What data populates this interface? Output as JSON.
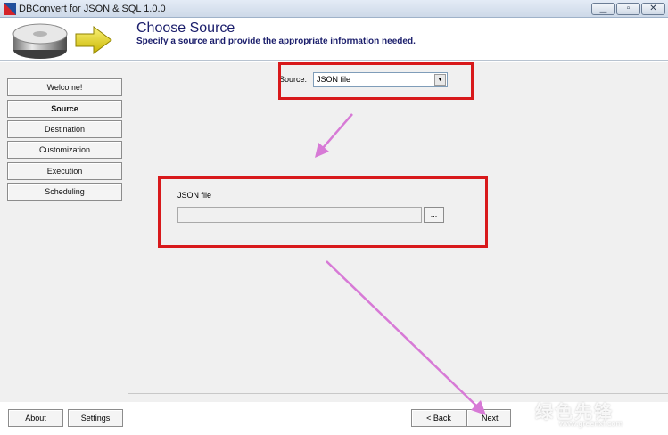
{
  "window": {
    "title": "DBConvert for JSON & SQL 1.0.0"
  },
  "header": {
    "title": "Choose Source",
    "subtitle": "Specify a source and provide the appropriate information needed."
  },
  "sidebar": {
    "items": [
      {
        "label": "Welcome!",
        "active": false
      },
      {
        "label": "Source",
        "active": true
      },
      {
        "label": "Destination",
        "active": false
      },
      {
        "label": "Customization",
        "active": false
      },
      {
        "label": "Execution",
        "active": false
      },
      {
        "label": "Scheduling",
        "active": false
      }
    ]
  },
  "source": {
    "label": "Source:",
    "selected": "JSON file"
  },
  "json_file": {
    "label": "JSON file",
    "value": "",
    "browse_label": "..."
  },
  "footer": {
    "about_label": "About",
    "settings_label": "Settings",
    "back_label": "< Back",
    "next_label": "Next"
  },
  "watermark": {
    "text": "绿色先锋",
    "url": "www.greenxf.com"
  },
  "colors": {
    "highlight": "#d8191b",
    "arrow": "#d77ad6",
    "title": "#1a1d6b"
  }
}
